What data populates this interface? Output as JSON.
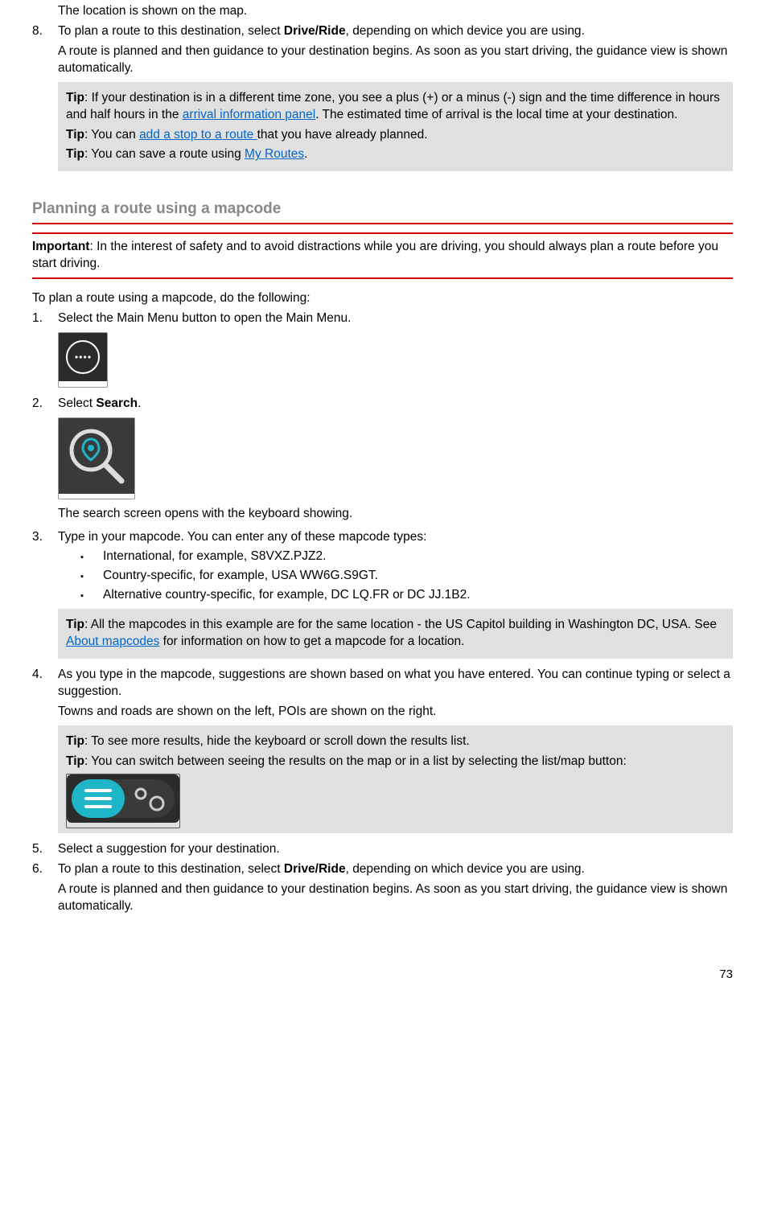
{
  "intro": {
    "location_shown": "The location is shown on the map.",
    "step8_num": "8.",
    "step8_a": "To plan a route to this destination, select ",
    "step8_bold": "Drive/Ride",
    "step8_b": ", depending on which device you are using.",
    "step8_para": "A route is planned and then guidance to your destination begins. As soon as you start driving, the guidance view is shown automatically."
  },
  "tipbox1": {
    "tip_label": "Tip",
    "t1a": ": If your destination is in a different time zone, you see a plus (+) or a minus (-) sign and the time difference in hours and half hours in the ",
    "t1link": "arrival information panel",
    "t1b": ". The estimated time of arrival is the local time at your destination.",
    "t2a": ": You can ",
    "t2link": "add a stop to a route  ",
    "t2b": " that you have already planned.",
    "t3a": ": You can save a route using ",
    "t3link": "My Routes",
    "t3b": "."
  },
  "heading": "Planning a route using a mapcode",
  "important": {
    "label": "Important",
    "text": ": In the interest of safety and to avoid distractions while you are driving, you should always plan a route before you start driving."
  },
  "plan_intro": "To plan a route using a mapcode, do the following:",
  "steps": {
    "s1_num": "1.",
    "s1_text": "Select the Main Menu button to open the Main Menu.",
    "s2_num": "2.",
    "s2_a": "Select ",
    "s2_bold": "Search",
    "s2_b": ".",
    "s2_para": "The search screen opens with the keyboard showing.",
    "s3_num": "3.",
    "s3_text": "Type in your mapcode. You can enter any of these mapcode types:",
    "b1": "International, for example, S8VXZ.PJZ2.",
    "b2": "Country-specific, for example, USA WW6G.S9GT.",
    "b3": "Alternative country-specific, for example, DC LQ.FR or DC JJ.1B2.",
    "s4_num": "4.",
    "s4_text": "As you type in the mapcode, suggestions are shown based on what you have entered. You can continue typing or select a suggestion.",
    "s4_para": "Towns and roads are shown on the left, POIs are shown on the right.",
    "s5_num": "5.",
    "s5_text": "Select a suggestion for your destination.",
    "s6_num": "6.",
    "s6_a": "To plan a route to this destination, select ",
    "s6_bold": "Drive/Ride",
    "s6_b": ", depending on which device you are using.",
    "s6_para": "A route is planned and then guidance to your destination begins. As soon as you start driving, the guidance view is shown automatically."
  },
  "tipbox2": {
    "tip_label": "Tip",
    "ta": ": All the mapcodes in this example are for the same location - the US Capitol building in Washington DC, USA. See ",
    "tlink": "About mapcodes",
    "tb": " for information on how to get a mapcode for a location."
  },
  "tipbox3": {
    "tip_label": "Tip",
    "t1": ": To see more results, hide the keyboard or scroll down the results list.",
    "t2": ": You can switch between seeing the results on the map or in a list by selecting the list/map button:"
  },
  "pagenum": "73"
}
